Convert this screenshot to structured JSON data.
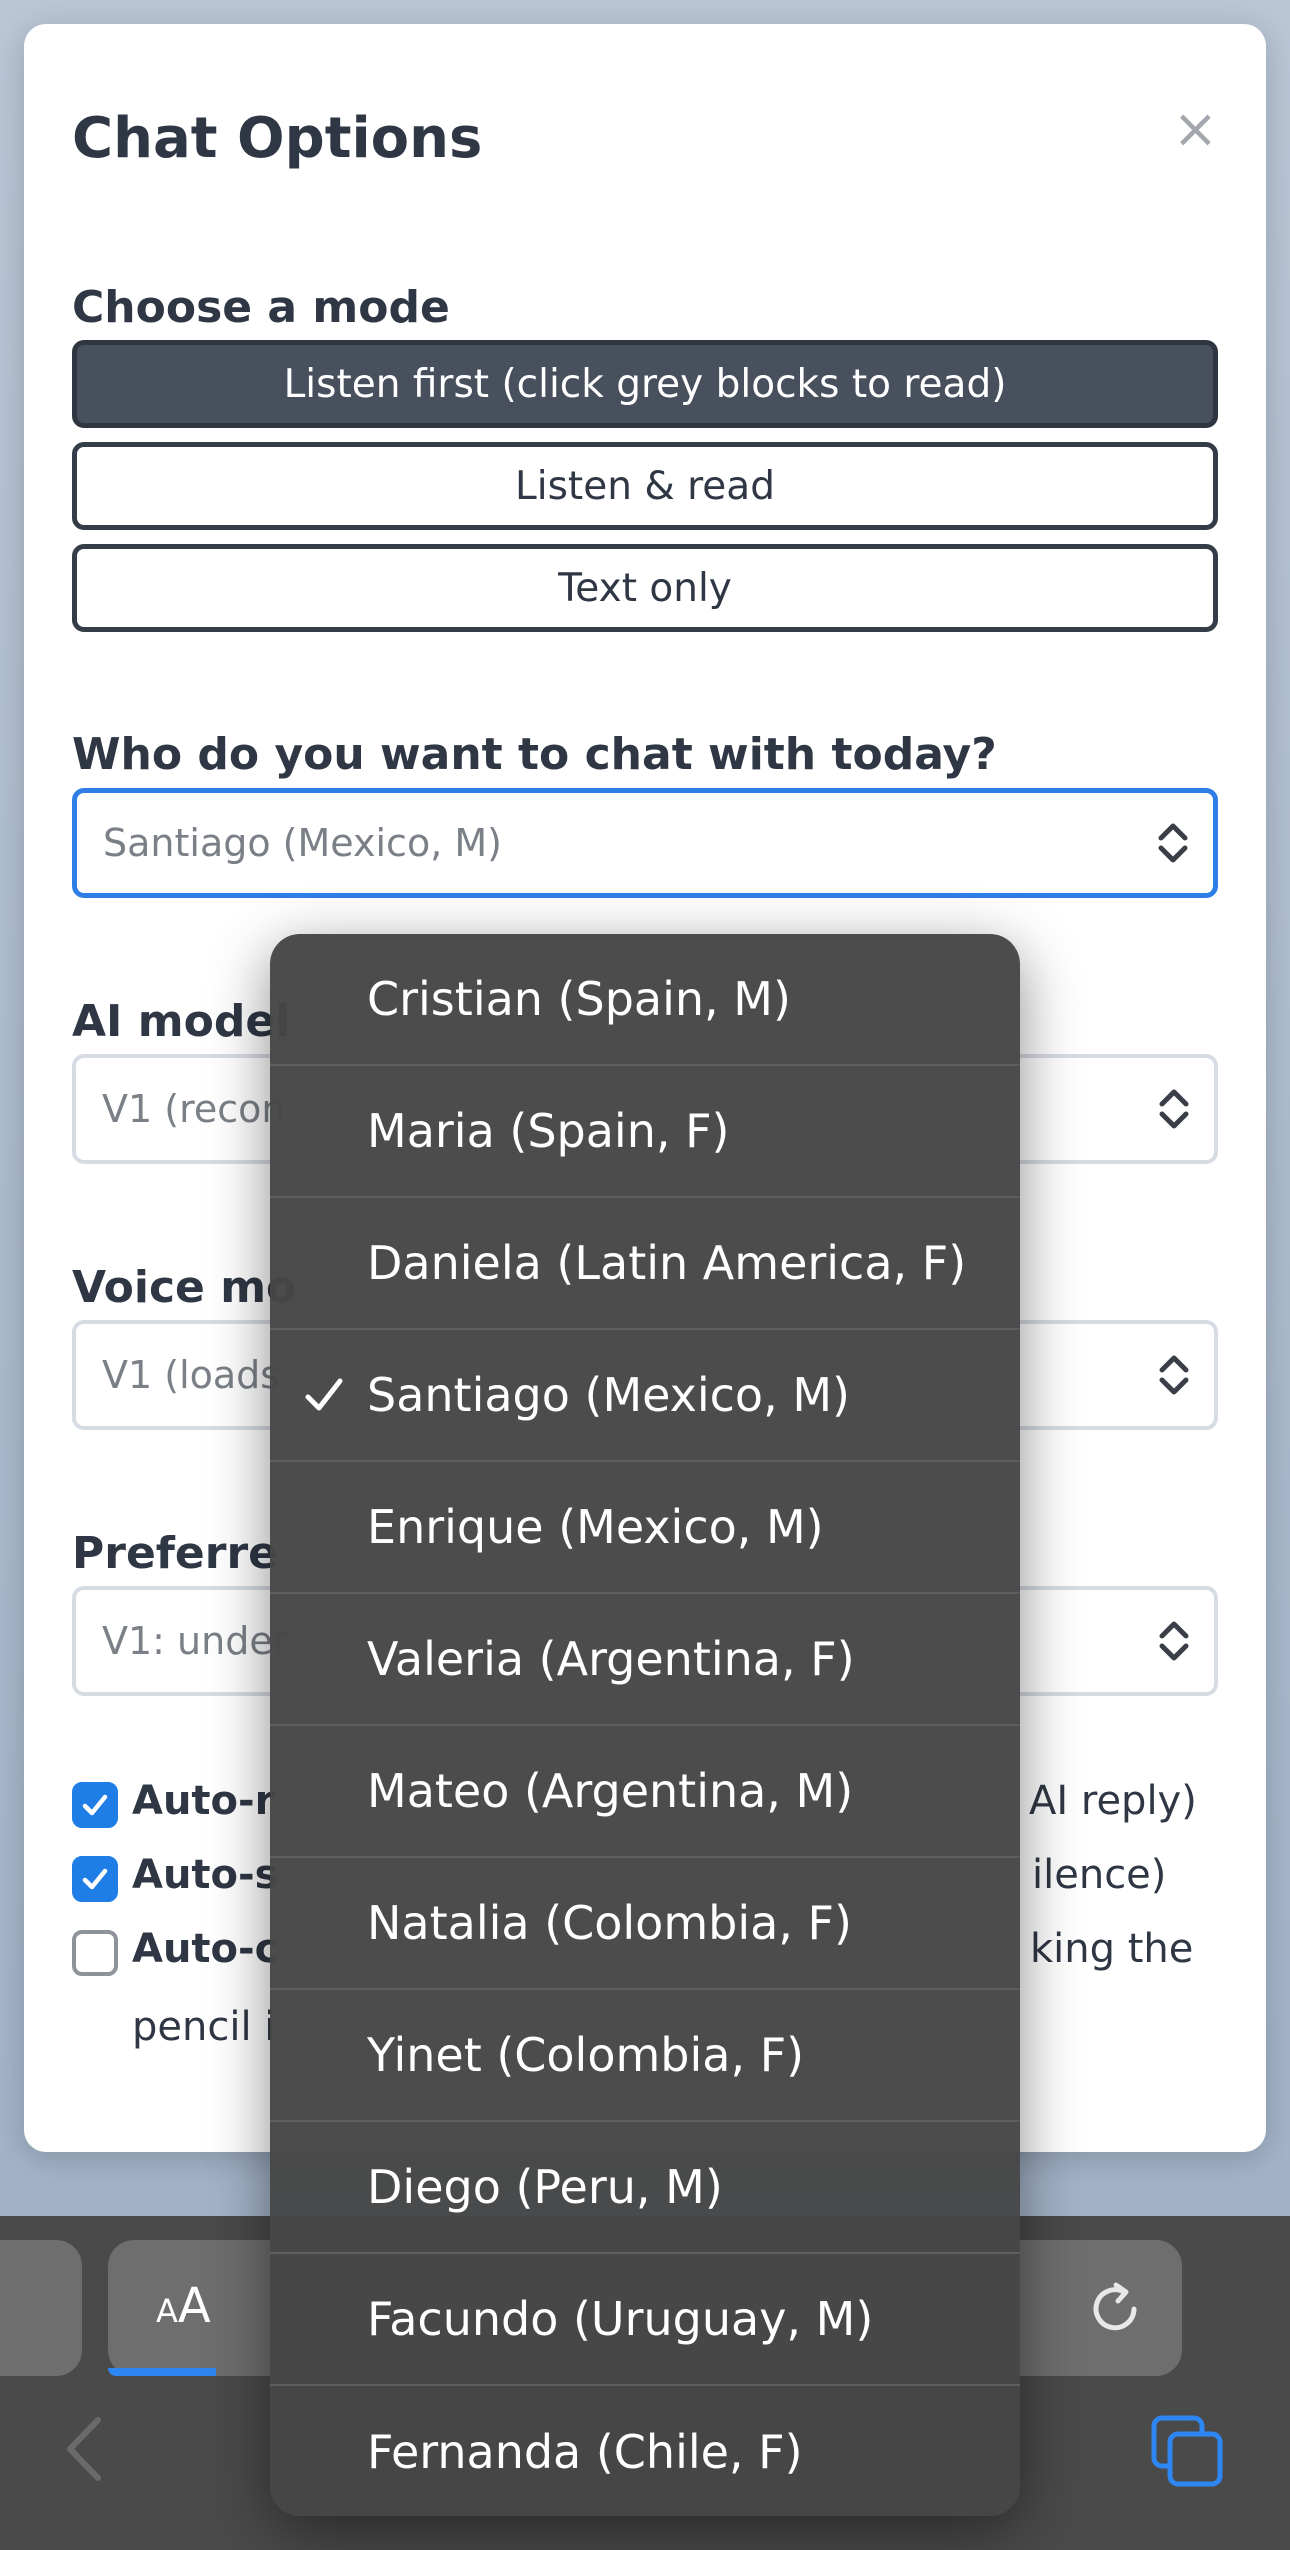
{
  "modal": {
    "title": "Chat Options",
    "close_label": "×",
    "mode_label": "Choose a mode",
    "modes": [
      {
        "label": "Listen first (click grey blocks to read)",
        "active": true
      },
      {
        "label": "Listen & read",
        "active": false
      },
      {
        "label": "Text only",
        "active": false
      }
    ],
    "partner_label": "Who do you want to chat with today?",
    "partner_value": "Santiago (Mexico, M)",
    "ai_model_label": "AI model",
    "ai_model_value": "V1 (recon",
    "voice_label": "Voice mo",
    "voice_value": "V1 (loads",
    "preferred_label": "Preferre",
    "preferred_value": "V1: under",
    "checks": [
      {
        "label": "Auto-r",
        "suffix": "AI reply)",
        "checked": true
      },
      {
        "label": "Auto-s",
        "suffix": "ilence)",
        "checked": true
      },
      {
        "label": "Auto-c",
        "suffix": "king the",
        "line2": "pencil i",
        "checked": false
      }
    ]
  },
  "picker": {
    "selected": "Santiago (Mexico, M)",
    "options": [
      "Cristian (Spain, M)",
      "Maria (Spain, F)",
      "Daniela (Latin America, F)",
      "Santiago (Mexico, M)",
      "Enrique (Mexico, M)",
      "Valeria (Argentina, F)",
      "Mateo (Argentina, M)",
      "Natalia (Colombia, F)",
      "Yinet (Colombia, F)",
      "Diego (Peru, M)",
      "Facundo (Uruguay, M)",
      "Fernanda (Chile, F)"
    ]
  },
  "toolbar": {
    "aa_small": "A",
    "aa_large": "A"
  },
  "colors": {
    "accent": "#1f7ee6",
    "active_mode_bg": "#48505d",
    "picker_bg": "#464646"
  }
}
